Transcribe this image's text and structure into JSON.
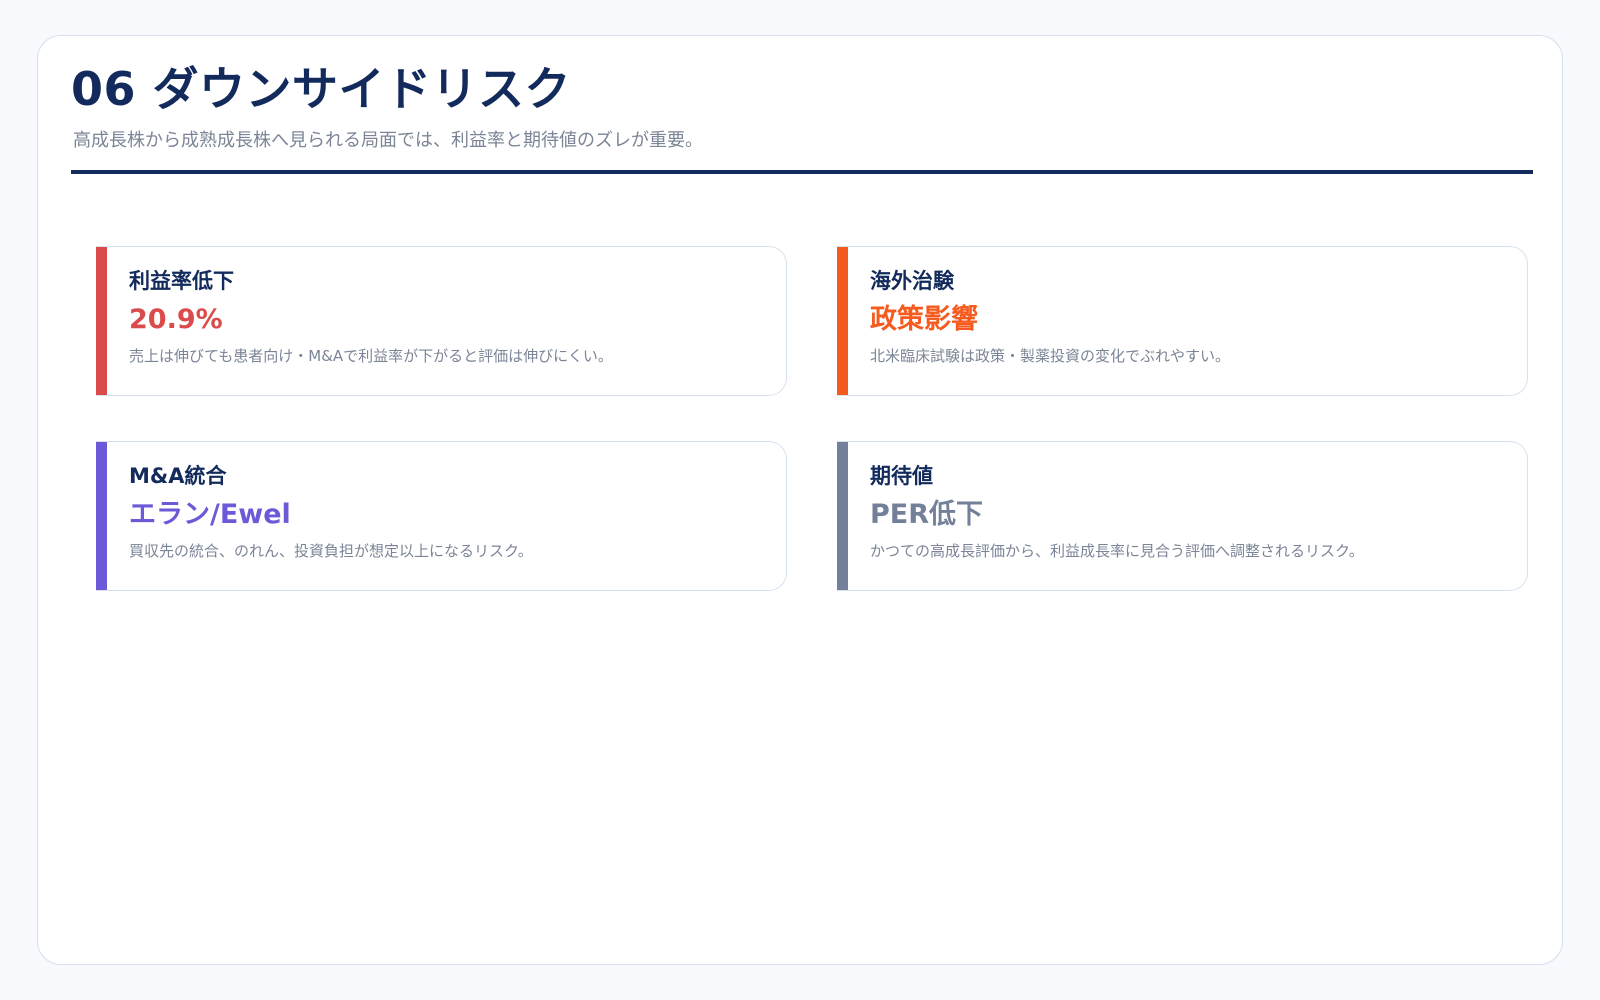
{
  "header": {
    "title": "06 ダウンサイドリスク",
    "subtitle": "高成長株から成熟成長株へ見られる局面では、利益率と期待値のズレが重要。"
  },
  "cards": [
    {
      "label": "利益率低下",
      "value": "20.9%",
      "description": "売上は伸びても患者向け・M&Aで利益率が下がると評価は伸びにくい。",
      "accent_color": "#dc4b4b"
    },
    {
      "label": "海外治験",
      "value": "政策影響",
      "description": "北米臨床試験は政策・製薬投資の変化でぶれやすい。",
      "accent_color": "#f55a1f"
    },
    {
      "label": "M&A統合",
      "value": "エラン/Ewel",
      "description": "買収先の統合、のれん、投資負担が想定以上になるリスク。",
      "accent_color": "#6a5ad8"
    },
    {
      "label": "期待値",
      "value": "PER低下",
      "description": "かつての高成長評価から、利益成長率に見合う評価へ調整されるリスク。",
      "accent_color": "#74809a"
    }
  ]
}
